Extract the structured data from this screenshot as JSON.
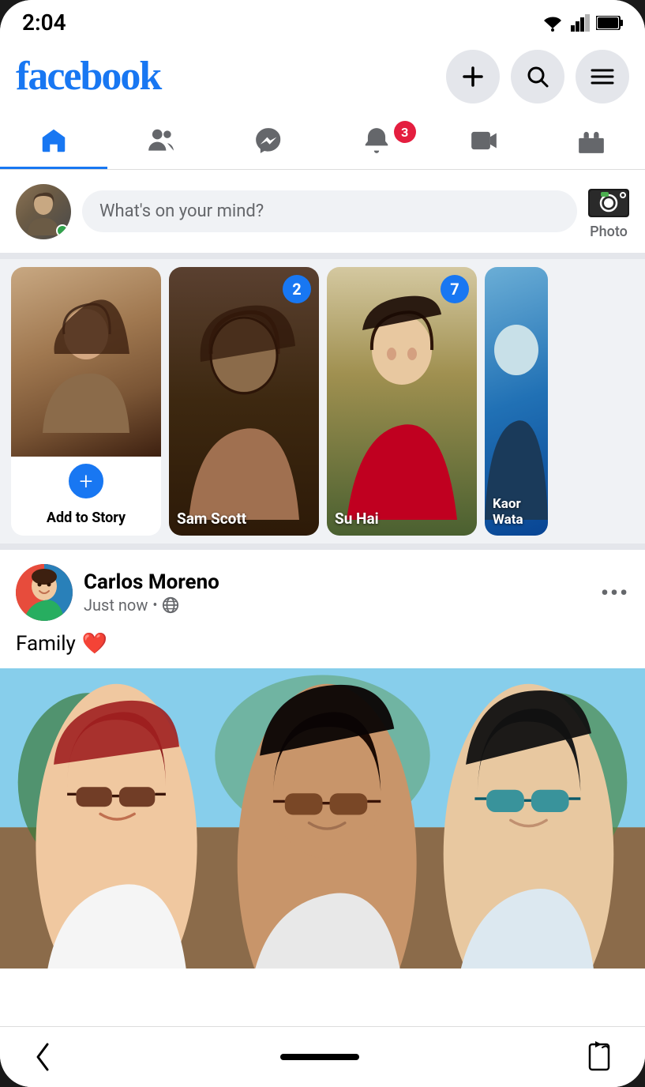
{
  "statusBar": {
    "time": "2:04",
    "wifi": true,
    "signal": true,
    "battery": true
  },
  "header": {
    "logo": "facebook",
    "addButton": "+",
    "searchButton": "🔍",
    "menuButton": "☰"
  },
  "navTabs": [
    {
      "id": "home",
      "active": true,
      "label": "Home"
    },
    {
      "id": "friends",
      "active": false,
      "label": "Friends"
    },
    {
      "id": "messenger",
      "active": false,
      "label": "Messenger"
    },
    {
      "id": "notifications",
      "active": false,
      "label": "Notifications",
      "badge": "3"
    },
    {
      "id": "video",
      "active": false,
      "label": "Video"
    },
    {
      "id": "marketplace",
      "active": false,
      "label": "Marketplace"
    }
  ],
  "createPost": {
    "placeholder": "What's on your mind?",
    "photoLabel": "Photo"
  },
  "stories": [
    {
      "id": "add",
      "label": "Add to Story",
      "type": "add"
    },
    {
      "id": "sam",
      "name": "Sam Scott",
      "count": "2",
      "type": "user"
    },
    {
      "id": "su",
      "name": "Su Hai",
      "count": "7",
      "type": "user"
    },
    {
      "id": "kaor",
      "name": "Kaor Wata",
      "count": null,
      "type": "user"
    }
  ],
  "post": {
    "author": "Carlos Moreno",
    "time": "Just now",
    "privacy": "globe",
    "text": "Family",
    "emoji": "❤️",
    "moreLabel": "•••"
  },
  "bottomNav": {
    "back": "‹",
    "home": "⬜",
    "rotate": "⟳"
  }
}
